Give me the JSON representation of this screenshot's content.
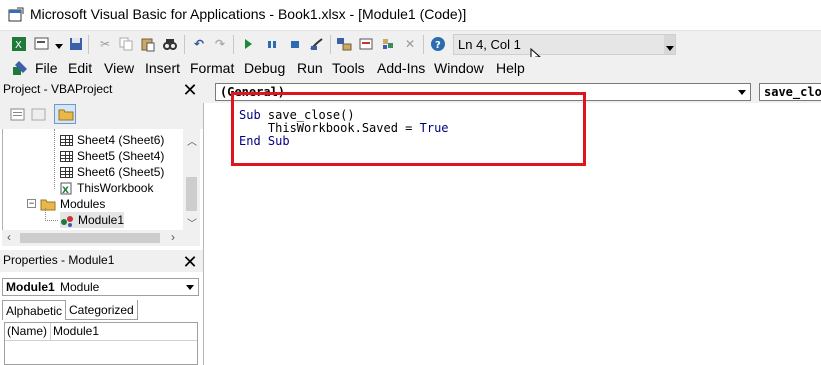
{
  "window": {
    "title": "Microsoft Visual Basic for Applications - Book1.xlsx - [Module1 (Code)]"
  },
  "toolbar": {
    "position": "Ln 4, Col 1"
  },
  "menu": [
    "File",
    "Edit",
    "View",
    "Insert",
    "Format",
    "Debug",
    "Run",
    "Tools",
    "Add-Ins",
    "Window",
    "Help"
  ],
  "project": {
    "title": "Project - VBAProject",
    "tree": [
      {
        "label": "Sheet4 (Sheet6)",
        "type": "sheet"
      },
      {
        "label": "Sheet5 (Sheet4)",
        "type": "sheet"
      },
      {
        "label": "Sheet6 (Sheet5)",
        "type": "sheet"
      },
      {
        "label": "ThisWorkbook",
        "type": "workbook"
      },
      {
        "label": "Modules",
        "type": "folder"
      },
      {
        "label": "Module1",
        "type": "module"
      }
    ]
  },
  "properties": {
    "title": "Properties - Module1",
    "selected_name": "Module1",
    "selected_type": "Module",
    "tabs": [
      "Alphabetic",
      "Categorized"
    ],
    "rows": [
      {
        "name": "(Name)",
        "value": "Module1"
      }
    ]
  },
  "code": {
    "object_combo": "(General)",
    "proc_combo": "save_clo",
    "line1_kw": "Sub",
    "line1_rest": " save_close()",
    "line2_rest": "    ThisWorkbook.Saved = ",
    "line2_kw": "True",
    "line3_kw": "End Sub"
  },
  "colors": {
    "highlight": "#e0141c",
    "keyword": "#00007f"
  }
}
